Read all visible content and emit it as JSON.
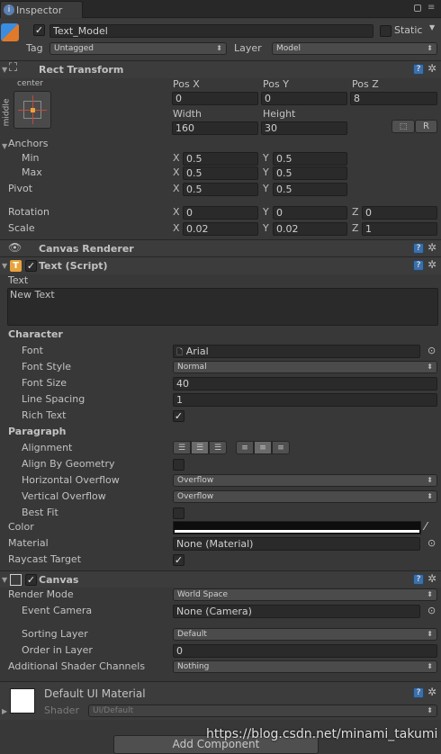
{
  "tab": {
    "title": "Inspector"
  },
  "go": {
    "name": "Text_Model",
    "static_label": "Static",
    "tag_label": "Tag",
    "tag_value": "Untagged",
    "layer_label": "Layer",
    "layer_value": "Model"
  },
  "rect": {
    "title": "Rect Transform",
    "anchor_h": "center",
    "anchor_v": "middle",
    "posx_label": "Pos X",
    "posy_label": "Pos Y",
    "posz_label": "Pos Z",
    "posx": "0",
    "posy": "0",
    "posz": "8",
    "width_label": "Width",
    "height_label": "Height",
    "width": "160",
    "height": "30",
    "reset_label": "R",
    "anchors_label": "Anchors",
    "min_label": "Min",
    "max_label": "Max",
    "pivot_label": "Pivot",
    "min_x": "0.5",
    "min_y": "0.5",
    "max_x": "0.5",
    "max_y": "0.5",
    "pivot_x": "0.5",
    "pivot_y": "0.5",
    "rotation_label": "Rotation",
    "scale_label": "Scale",
    "rot_x": "0",
    "rot_y": "0",
    "rot_z": "0",
    "scale_x": "0.02",
    "scale_y": "0.02",
    "scale_z": "1",
    "x": "X",
    "y": "Y",
    "z": "Z"
  },
  "canvas_renderer": {
    "title": "Canvas Renderer"
  },
  "text": {
    "title": "Text (Script)",
    "text_label": "Text",
    "text_value": "New Text",
    "character_label": "Character",
    "font_label": "Font",
    "font_value": "Arial",
    "font_style_label": "Font Style",
    "font_style_value": "Normal",
    "font_size_label": "Font Size",
    "font_size_value": "40",
    "line_spacing_label": "Line Spacing",
    "line_spacing_value": "1",
    "rich_text_label": "Rich Text",
    "paragraph_label": "Paragraph",
    "alignment_label": "Alignment",
    "align_geom_label": "Align By Geometry",
    "h_overflow_label": "Horizontal Overflow",
    "h_overflow_value": "Overflow",
    "v_overflow_label": "Vertical Overflow",
    "v_overflow_value": "Overflow",
    "best_fit_label": "Best Fit",
    "color_label": "Color",
    "material_label": "Material",
    "material_value": "None (Material)",
    "raycast_label": "Raycast Target"
  },
  "canvas": {
    "title": "Canvas",
    "render_mode_label": "Render Mode",
    "render_mode_value": "World Space",
    "event_camera_label": "Event Camera",
    "event_camera_value": "None (Camera)",
    "sorting_layer_label": "Sorting Layer",
    "sorting_layer_value": "Default",
    "order_label": "Order in Layer",
    "order_value": "0",
    "shader_channels_label": "Additional Shader Channels",
    "shader_channels_value": "Nothing"
  },
  "material": {
    "title": "Default UI Material",
    "shader_label": "Shader",
    "shader_value": "UI/Default"
  },
  "footer": {
    "add_component": "Add Component",
    "watermark": "https://blog.csdn.net/minami_takumi"
  },
  "colors": {
    "bg": "#383838",
    "field": "#2a2a2a",
    "help": "#3d6fa8",
    "text_icon": "#e8a33b"
  }
}
